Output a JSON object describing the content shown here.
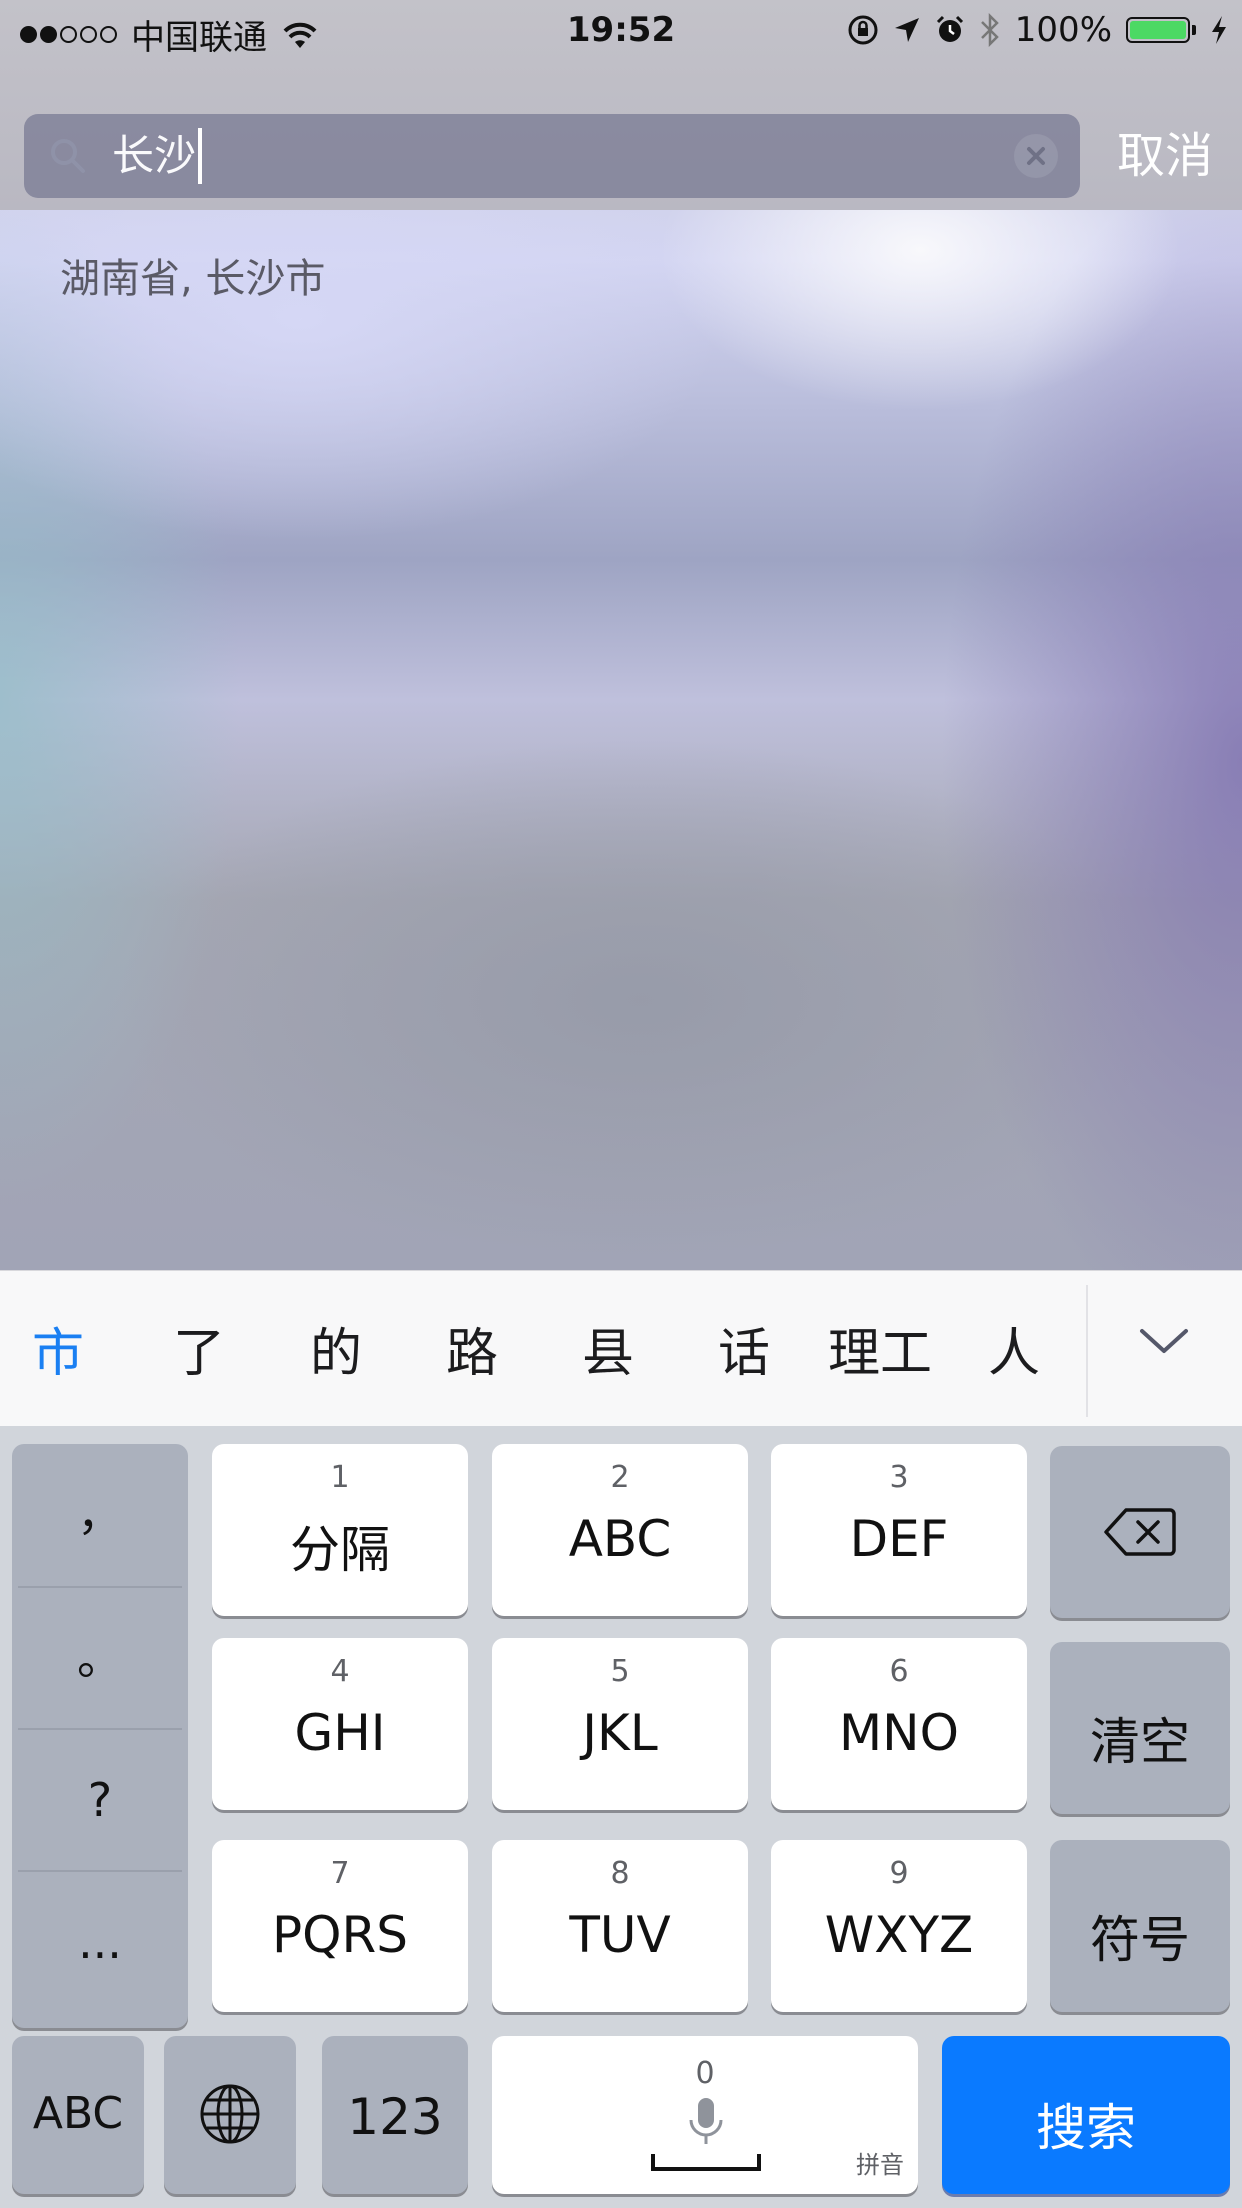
{
  "status_bar": {
    "carrier": "中国联通",
    "time": "19:52",
    "battery_percent": "100%",
    "signal_bars_filled": 2,
    "signal_bars_total": 5,
    "icons": [
      "wifi-icon",
      "orientation-lock-icon",
      "location-arrow-icon",
      "alarm-icon",
      "bluetooth-icon",
      "charging-bolt-icon"
    ]
  },
  "search": {
    "value": "长沙",
    "cancel_label": "取消"
  },
  "results": [
    {
      "label": "湖南省, 长沙市"
    }
  ],
  "candidates": [
    "市",
    "了",
    "的",
    "路",
    "县",
    "话",
    "理工",
    "人"
  ],
  "keyboard": {
    "punctuation": [
      "，",
      "。",
      "?",
      "..."
    ],
    "keys": [
      {
        "num": "1",
        "label": "分隔"
      },
      {
        "num": "2",
        "label": "ABC"
      },
      {
        "num": "3",
        "label": "DEF"
      },
      {
        "num": "4",
        "label": "GHI"
      },
      {
        "num": "5",
        "label": "JKL"
      },
      {
        "num": "6",
        "label": "MNO"
      },
      {
        "num": "7",
        "label": "PQRS"
      },
      {
        "num": "8",
        "label": "TUV"
      },
      {
        "num": "9",
        "label": "WXYZ"
      }
    ],
    "clear_label": "清空",
    "symbol_label": "符号",
    "abc_label": "ABC",
    "numbers_label": "123",
    "space_number": "0",
    "space_hint": "拼音",
    "search_label": "搜索"
  },
  "colors": {
    "accent": "#0a7aff",
    "candidate_active": "#1a7ff2",
    "battery_fill": "#4cd964"
  }
}
